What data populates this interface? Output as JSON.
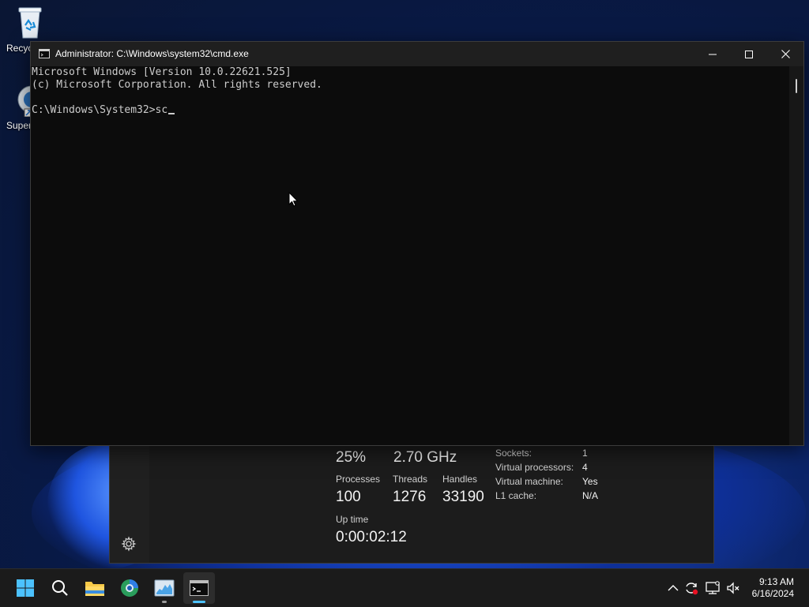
{
  "desktop": {
    "icons": [
      {
        "label": "Recycle Bin",
        "visible_label": "Recyc"
      },
      {
        "label": "SuperMicro",
        "visible_label": "Super"
      }
    ]
  },
  "console": {
    "title": "Administrator: C:\\Windows\\system32\\cmd.exe",
    "lines": [
      "Microsoft Windows [Version 10.0.22621.525]",
      "(c) Microsoft Corporation. All rights reserved.",
      "",
      "C:\\Windows\\System32>sc"
    ],
    "text_color": "#cccccc",
    "background": "#0c0c0c"
  },
  "task_manager": {
    "utilization": "25%",
    "speed": "2.70 GHz",
    "processes_label": "Processes",
    "processes_value": "100",
    "threads_label": "Threads",
    "threads_value": "1276",
    "handles_label": "Handles",
    "handles_value": "33190",
    "uptime_label": "Up time",
    "uptime_value": "0:00:02:12",
    "details": [
      {
        "key": "Sockets:",
        "value": "1"
      },
      {
        "key": "Virtual processors:",
        "value": "4"
      },
      {
        "key": "Virtual machine:",
        "value": "Yes"
      },
      {
        "key": "L1 cache:",
        "value": "N/A"
      }
    ]
  },
  "taskbar": {
    "apps": [
      "start-icon",
      "search-icon",
      "file-explorer-icon",
      "browser-icon",
      "task-manager-icon",
      "command-prompt-icon"
    ],
    "active_app": "command-prompt-icon",
    "accent": "#4cc2ff",
    "clock_time": "9:13 AM",
    "clock_date": "6/16/2024"
  }
}
